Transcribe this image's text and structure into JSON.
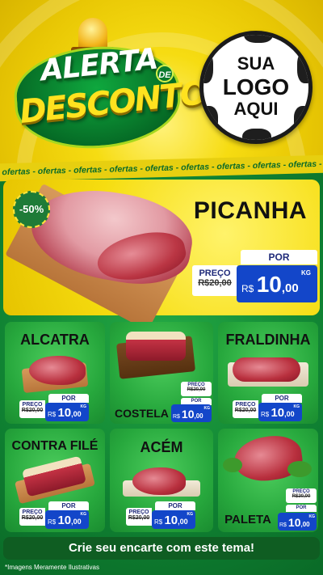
{
  "header": {
    "alerta": "ALERTA",
    "de": "DE",
    "desconto": "DESCONTO",
    "logo": {
      "line1": "SUA",
      "line2": "LOGO",
      "line3": "AQUI"
    }
  },
  "strip_text": "- ofertas - ofertas - ofertas - ofertas - ofertas - ofertas - ofertas - ofertas - ofertas -",
  "featured": {
    "discount": "-50%",
    "name": "PICANHA",
    "price": {
      "old_label": "PREÇO",
      "old": "R$20,00",
      "por": "POR",
      "currency": "R$",
      "whole": "10",
      "cents": ",00",
      "unit": "KG"
    }
  },
  "products": [
    {
      "name": "ALCATRA",
      "price": {
        "old_label": "PREÇO",
        "old": "R$20,00",
        "por": "POR",
        "currency": "R$",
        "whole": "10",
        "cents": ",00",
        "unit": "KG"
      }
    },
    {
      "name": "COSTELA",
      "price": {
        "old_label": "PREÇO",
        "old": "R$20,00",
        "por": "POR",
        "currency": "R$",
        "whole": "10",
        "cents": ",00",
        "unit": "KG"
      }
    },
    {
      "name": "FRALDINHA",
      "price": {
        "old_label": "PREÇO",
        "old": "R$20,00",
        "por": "POR",
        "currency": "R$",
        "whole": "10",
        "cents": ",00",
        "unit": "KG"
      }
    },
    {
      "name": "CONTRA FILÉ",
      "price": {
        "old_label": "PREÇO",
        "old": "R$20,00",
        "por": "POR",
        "currency": "R$",
        "whole": "10",
        "cents": ",00",
        "unit": "KG"
      }
    },
    {
      "name": "ACÉM",
      "price": {
        "old_label": "PREÇO",
        "old": "R$20,00",
        "por": "POR",
        "currency": "R$",
        "whole": "10",
        "cents": ",00",
        "unit": "KG"
      }
    },
    {
      "name": "PALETA",
      "price": {
        "old_label": "PREÇO",
        "old": "R$20,00",
        "por": "POR",
        "currency": "R$",
        "whole": "10",
        "cents": ",00",
        "unit": "KG"
      }
    }
  ],
  "footer": {
    "cta": "Crie seu encarte com este tema!",
    "disclaimer": "*Imagens Meramente Ilustrativas"
  },
  "colors": {
    "yellow": "#f6dc12",
    "green": "#0f8132",
    "blue": "#1346c9",
    "card_green": "#27a83d"
  }
}
